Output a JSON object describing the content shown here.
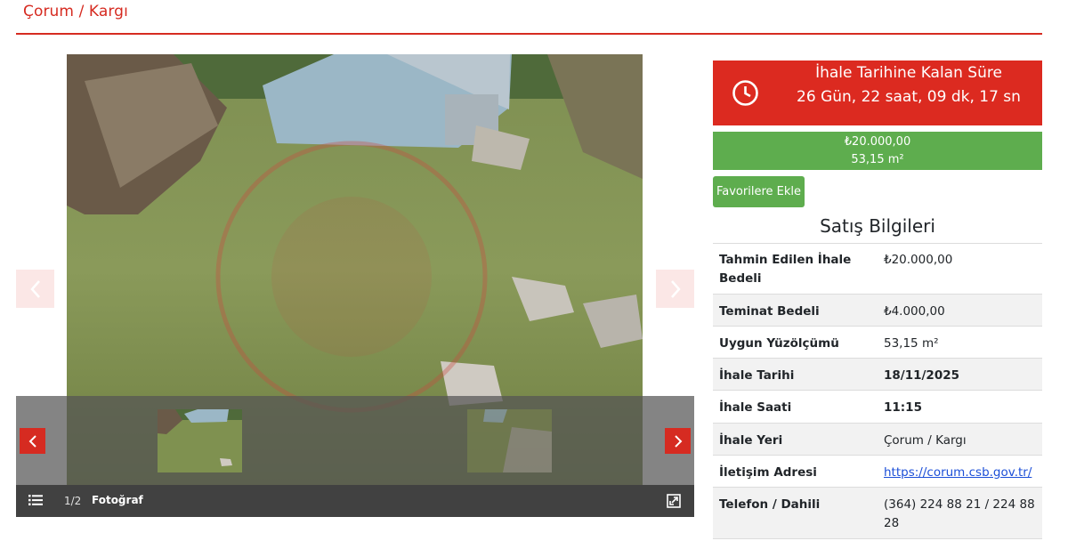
{
  "page": {
    "title": "Çorum / Kargı"
  },
  "gallery": {
    "counter": "1/2",
    "photo_label": "Fotoğraf",
    "icons": [
      "chevron-left-icon",
      "chevron-right-icon",
      "list-icon",
      "expand-icon"
    ]
  },
  "countdown": {
    "label": "İhale Tarihine Kalan Süre",
    "value": "26 Gün, 22 saat, 09 dk, 17 sn",
    "icon": "clock-icon"
  },
  "price": {
    "amount": "₺20.000,00",
    "area": "53,15 m²"
  },
  "favorite_button": "Favorilere Ekle",
  "sales_info": {
    "title": "Satış Bilgileri",
    "rows": [
      {
        "key": "Tahmin Edilen İhale Bedeli",
        "value": "₺20.000,00"
      },
      {
        "key": "Teminat Bedeli",
        "value": "₺4.000,00"
      },
      {
        "key": "Uygun Yüzölçümü",
        "value": "53,15 m²"
      },
      {
        "key": "İhale Tarihi",
        "value": "18/11/2025"
      },
      {
        "key": "İhale Saati",
        "value": "11:15"
      },
      {
        "key": "İhale Yeri",
        "value": "Çorum / Kargı"
      },
      {
        "key": "İletişim Adresi",
        "value": "https://corum.csb.gov.tr/"
      },
      {
        "key": "Telefon / Dahili",
        "value": "(364) 224 88 21 / 224 88 28"
      }
    ]
  },
  "colors": {
    "red": "#dc2a20",
    "green": "#5ead4e",
    "link": "#1c4fd8"
  }
}
